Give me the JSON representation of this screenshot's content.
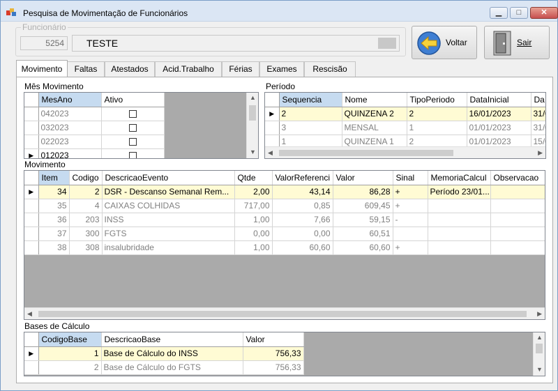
{
  "window": {
    "title": "Pesquisa de Movimentação de Funcionários"
  },
  "funcionario": {
    "label": "Funcionário",
    "code": "5254",
    "name": "TESTE"
  },
  "buttons": {
    "voltar": "Voltar",
    "sair": "Sair"
  },
  "tabs": [
    "Movimento",
    "Faltas",
    "Atestados",
    "Acid.Trabalho",
    "Férias",
    "Exames",
    "Rescisão"
  ],
  "mes_movimento": {
    "label": "Mês Movimento",
    "columns": [
      "MesAno",
      "Ativo"
    ],
    "rows": [
      {
        "mesano": "042023",
        "ativo": false
      },
      {
        "mesano": "032023",
        "ativo": false
      },
      {
        "mesano": "022023",
        "ativo": false
      },
      {
        "mesano": "012023",
        "ativo": false
      }
    ]
  },
  "periodo": {
    "label": "Período",
    "columns": [
      "Sequencia",
      "Nome",
      "TipoPeriodo",
      "DataInicial",
      "Da"
    ],
    "rows": [
      {
        "seq": "2",
        "nome": "QUINZENA 2",
        "tipo": "2",
        "inicio": "16/01/2023",
        "fim": "31/0"
      },
      {
        "seq": "3",
        "nome": "MENSAL",
        "tipo": "1",
        "inicio": "01/01/2023",
        "fim": "31/0"
      },
      {
        "seq": "1",
        "nome": "QUINZENA 1",
        "tipo": "2",
        "inicio": "01/01/2023",
        "fim": "15/0"
      }
    ]
  },
  "movimento": {
    "label": "Movimento",
    "columns": [
      "Item",
      "Codigo",
      "DescricaoEvento",
      "Qtde",
      "ValorReferenci",
      "Valor",
      "Sinal",
      "MemoriaCalcul",
      "Observacao"
    ],
    "rows": [
      {
        "item": "34",
        "codigo": "2",
        "desc": "DSR - Descanso Semanal Rem...",
        "qtde": "2,00",
        "ref": "43,14",
        "valor": "86,28",
        "sinal": "+",
        "memoria": "Período 23/01...",
        "obs": ""
      },
      {
        "item": "35",
        "codigo": "4",
        "desc": "CAIXAS COLHIDAS",
        "qtde": "717,00",
        "ref": "0,85",
        "valor": "609,45",
        "sinal": "+",
        "memoria": "",
        "obs": ""
      },
      {
        "item": "36",
        "codigo": "203",
        "desc": "INSS",
        "qtde": "1,00",
        "ref": "7,66",
        "valor": "59,15",
        "sinal": "-",
        "memoria": "",
        "obs": ""
      },
      {
        "item": "37",
        "codigo": "300",
        "desc": "FGTS",
        "qtde": "0,00",
        "ref": "0,00",
        "valor": "60,51",
        "sinal": "",
        "memoria": "",
        "obs": ""
      },
      {
        "item": "38",
        "codigo": "308",
        "desc": "insalubridade",
        "qtde": "1,00",
        "ref": "60,60",
        "valor": "60,60",
        "sinal": "+",
        "memoria": "",
        "obs": ""
      }
    ]
  },
  "bases": {
    "label": "Bases de Cálculo",
    "columns": [
      "CodigoBase",
      "DescricaoBase",
      "Valor"
    ],
    "rows": [
      {
        "codigo": "1",
        "desc": "Base de Cálculo do INSS",
        "valor": "756,33"
      },
      {
        "codigo": "2",
        "desc": "Base de Cálculo do FGTS",
        "valor": "756,33"
      }
    ]
  }
}
